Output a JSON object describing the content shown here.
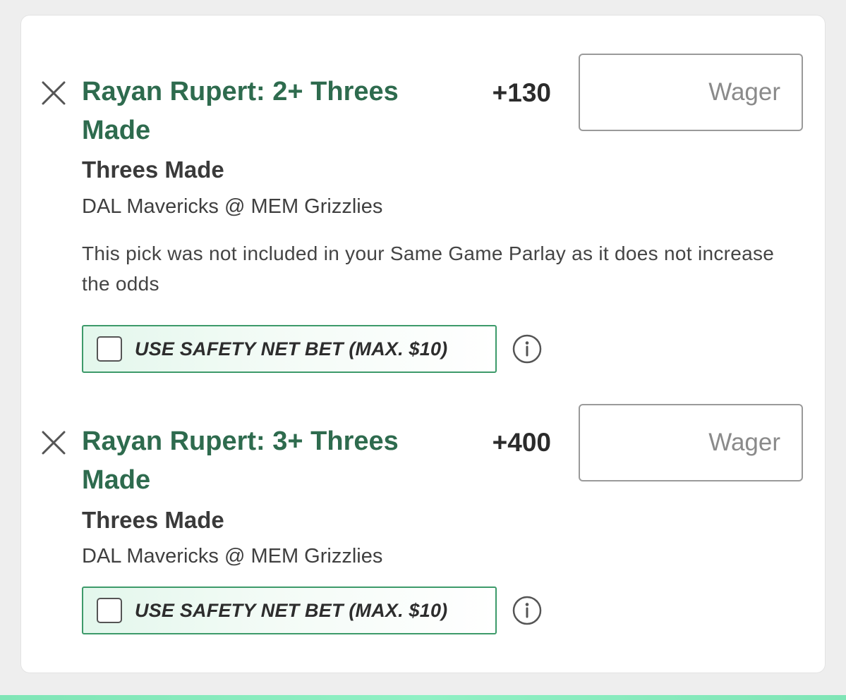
{
  "picks": [
    {
      "title": "Rayan Rupert: 2+ Threes Made",
      "odds": "+130",
      "wager_placeholder": "Wager",
      "market": "Threes Made",
      "matchup": "DAL Mavericks @ MEM Grizzlies",
      "notice": "This pick was not included in your Same Game Parlay as it does not increase the odds",
      "safety_net_label": "USE SAFETY NET BET (MAX. $10)",
      "safety_net_checked": false
    },
    {
      "title": "Rayan Rupert: 3+ Threes Made",
      "odds": "+400",
      "wager_placeholder": "Wager",
      "market": "Threes Made",
      "matchup": "DAL Mavericks @ MEM Grizzlies",
      "safety_net_label": "USE SAFETY NET BET (MAX. $10)",
      "safety_net_checked": false
    }
  ],
  "icons": {
    "remove": "close-icon",
    "info": "info-icon"
  },
  "colors": {
    "title_green": "#2e6b4e",
    "safety_border": "#3d9a6a",
    "safety_bg": "#e3f7ec",
    "bottom_bar": "#8ff0c4"
  }
}
